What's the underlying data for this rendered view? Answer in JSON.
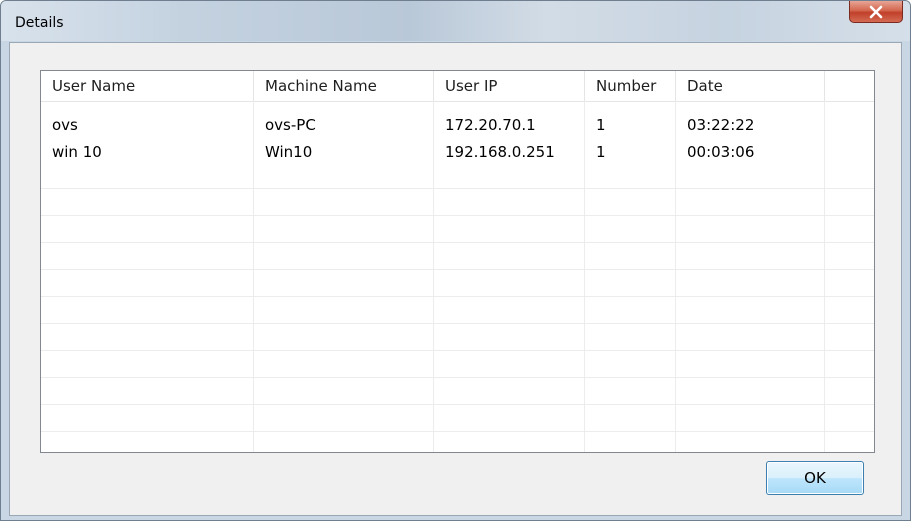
{
  "window": {
    "title": "Details"
  },
  "table": {
    "columns": [
      "User Name",
      "Machine Name",
      "User IP",
      "Number",
      "Date"
    ],
    "rows": [
      [
        "ovs",
        "ovs-PC",
        "172.20.70.1",
        "1",
        "03:22:22"
      ],
      [
        "win 10",
        "Win10",
        "192.168.0.251",
        "1",
        "00:03:06"
      ]
    ]
  },
  "footer": {
    "ok_label": "OK"
  },
  "colors": {
    "close_button": "#c1402a",
    "ok_border": "#3c7fb1",
    "client_bg": "#f0f0f0"
  },
  "icons": {
    "close": "close-icon"
  }
}
